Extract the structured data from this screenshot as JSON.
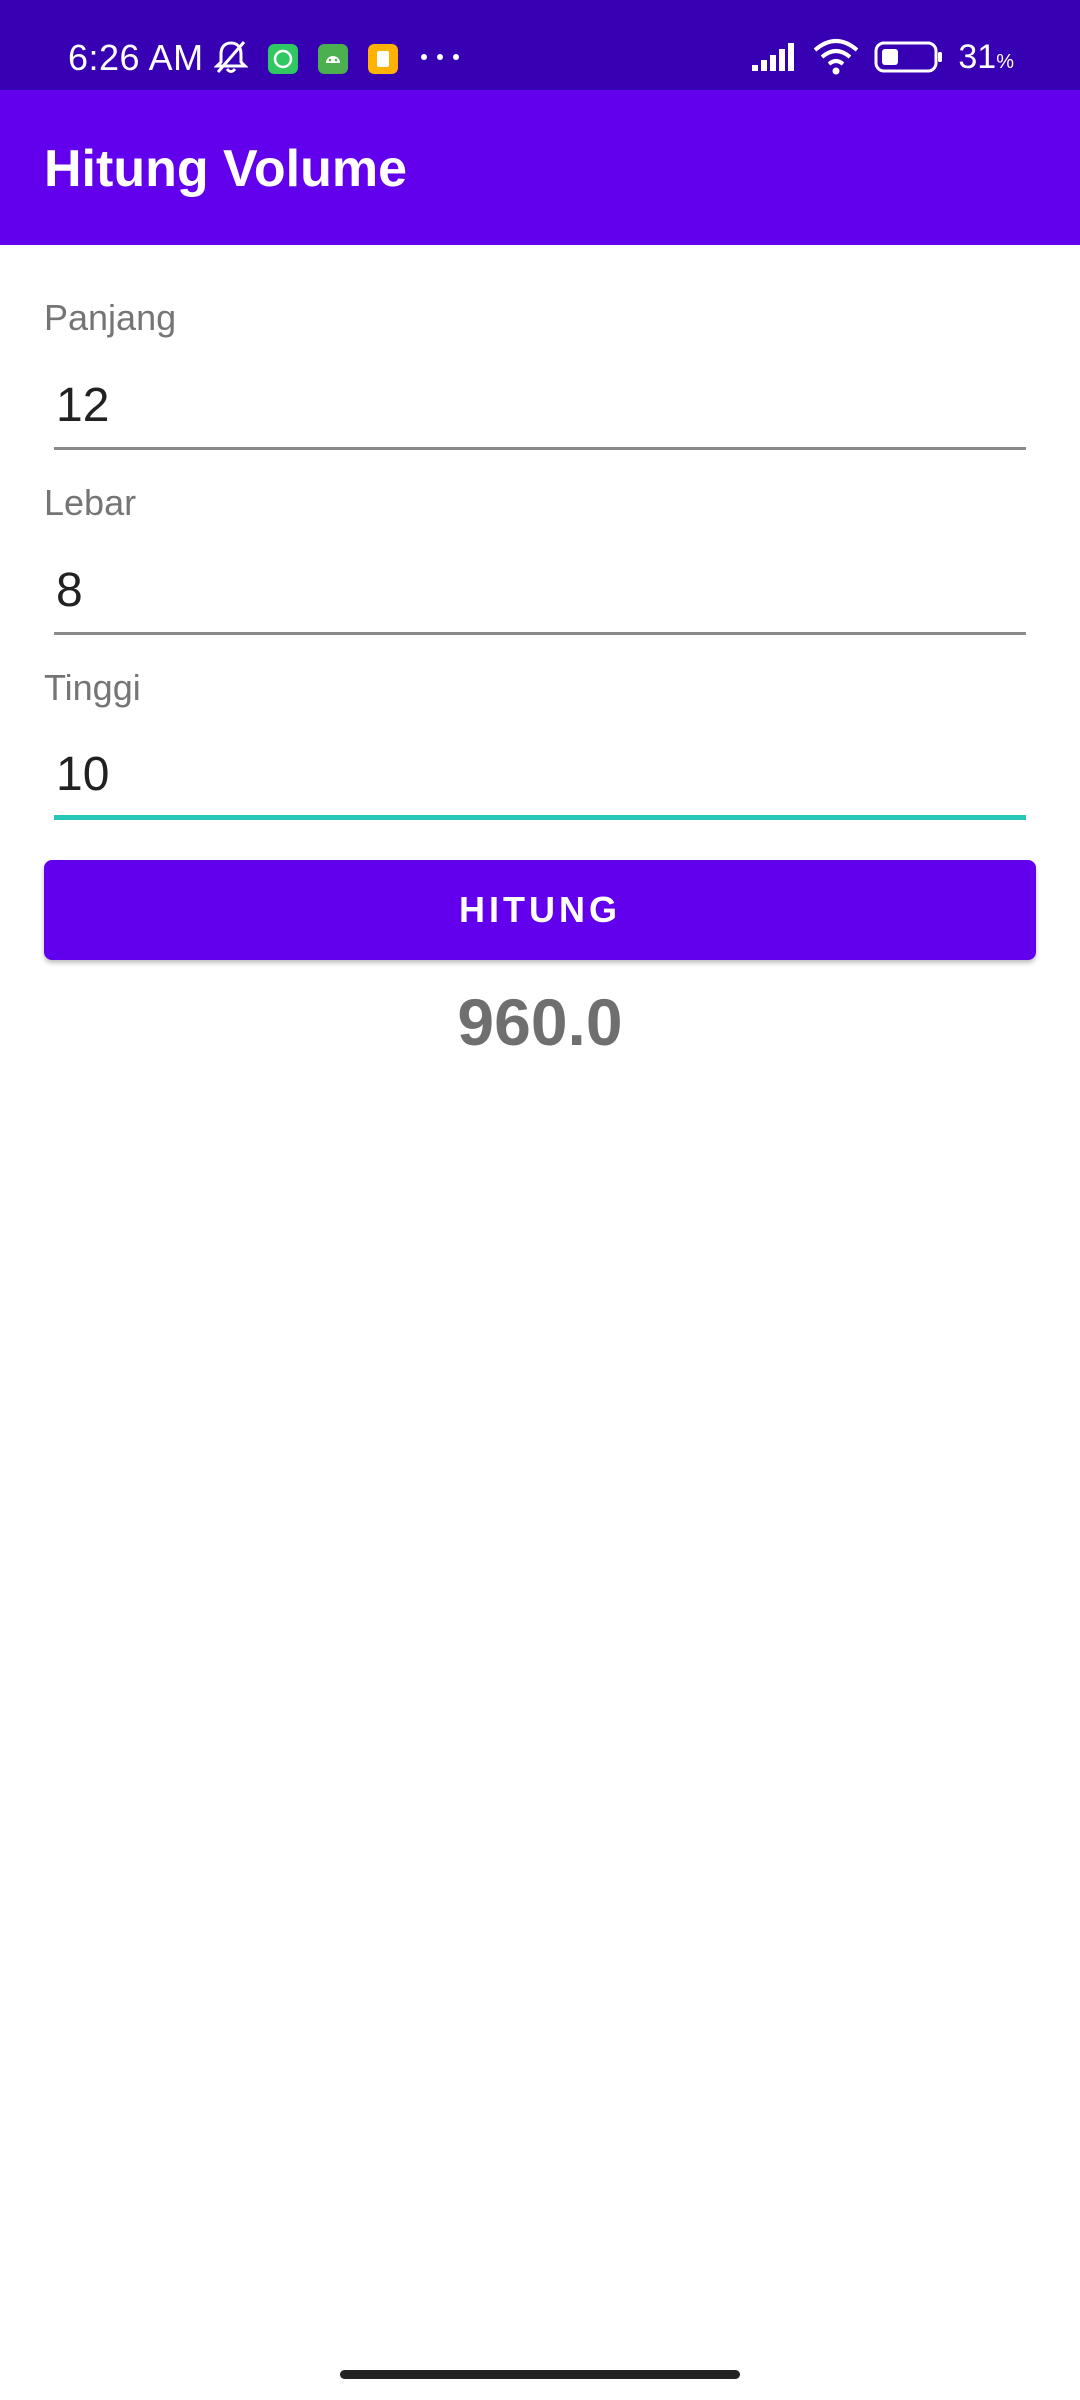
{
  "status_bar": {
    "time": "6:26 AM",
    "battery_percent": "31",
    "battery_suffix": "%",
    "icons_left": [
      "bell-off-icon",
      "whatsapp-icon",
      "android-icon",
      "note-icon",
      "more-dots-icon"
    ],
    "icons_right": [
      "signal-icon",
      "wifi-icon",
      "battery-icon"
    ],
    "colors": {
      "background": "#3700b3"
    }
  },
  "app_bar": {
    "title": "Hitung Volume",
    "color": "#6200ee"
  },
  "form": {
    "panjang": {
      "label": "Panjang",
      "value": "12"
    },
    "lebar": {
      "label": "Lebar",
      "value": "8"
    },
    "tinggi": {
      "label": "Tinggi",
      "value": "10"
    }
  },
  "actions": {
    "hitung_label": "HITUNG"
  },
  "result": {
    "value": "960.0"
  },
  "colors": {
    "accent": "#6200ee",
    "focus_underline": "#26c6b8"
  }
}
